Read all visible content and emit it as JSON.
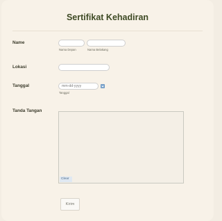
{
  "form": {
    "title": "Sertifikat Kehadiran",
    "name": {
      "label": "Name",
      "first_sublabel": "Nama Depan",
      "last_sublabel": "Nama Belakang",
      "first_value": "",
      "last_value": ""
    },
    "location": {
      "label": "Lokasi",
      "value": ""
    },
    "date": {
      "label": "Tanggal",
      "placeholder": "mm-dd-yyyy",
      "sublabel": "Tanggal",
      "icon": "calendar-icon"
    },
    "signature": {
      "label": "Tanda Tangan",
      "clear_label": "Clear"
    },
    "submit_label": "Kirim"
  }
}
